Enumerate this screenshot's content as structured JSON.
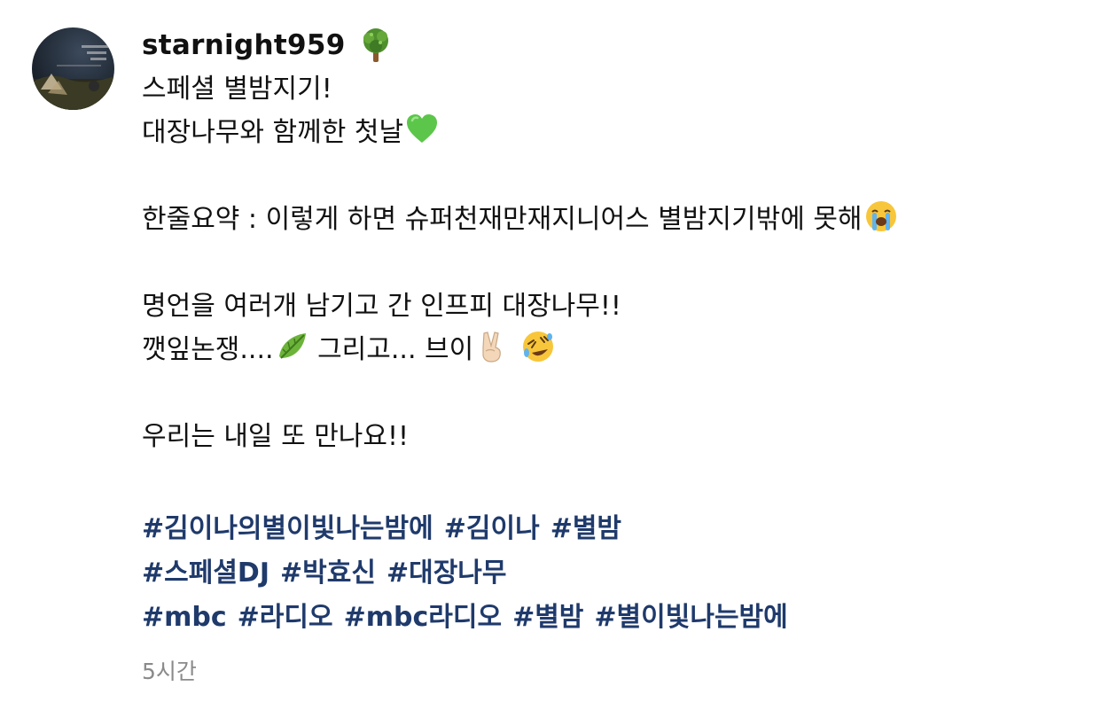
{
  "post": {
    "username": "starnight959",
    "badge_icon": "tree-icon",
    "avatar_icon": "profile-photo-radio-show",
    "lines": [
      {
        "text": "스페셜 별밤지기!",
        "emoji": ""
      },
      {
        "text": "대장나무와 함께한 첫날",
        "emoji": "green-heart-icon"
      },
      {
        "text": "",
        "emoji": ""
      },
      {
        "text": "한줄요약 : 이렇게 하면 슈퍼천재만재지니어스 별밤지기밖에 못해",
        "emoji": "loudly-crying-face-icon"
      },
      {
        "text": "",
        "emoji": ""
      },
      {
        "text": "명언을 여러개 남기고 간 인프피 대장나무!!",
        "emoji": ""
      },
      {
        "text": "깻잎논쟁....",
        "emoji": "leaf-icon",
        "text2": " 그리고... 브이",
        "emoji2": "victory-hand-icon",
        "emoji3": "rolling-laughing-face-icon"
      },
      {
        "text": "",
        "emoji": ""
      },
      {
        "text": "우리는 내일 또 만나요!!",
        "emoji": ""
      },
      {
        "text": "",
        "emoji": ""
      }
    ],
    "hashtag_rows": [
      [
        "#김이나의별이빛나는밤에",
        "#김이나",
        "#별밤"
      ],
      [
        "#스페셜DJ",
        "#박효신",
        "#대장나무"
      ],
      [
        "#mbc",
        "#라디오",
        "#mbc라디오",
        "#별밤",
        "#별이빛나는밤에"
      ]
    ],
    "timestamp": "5시간",
    "colors": {
      "hashtag": "#1f3a6b",
      "timestamp": "#8a8a8a",
      "text": "#111111"
    }
  }
}
